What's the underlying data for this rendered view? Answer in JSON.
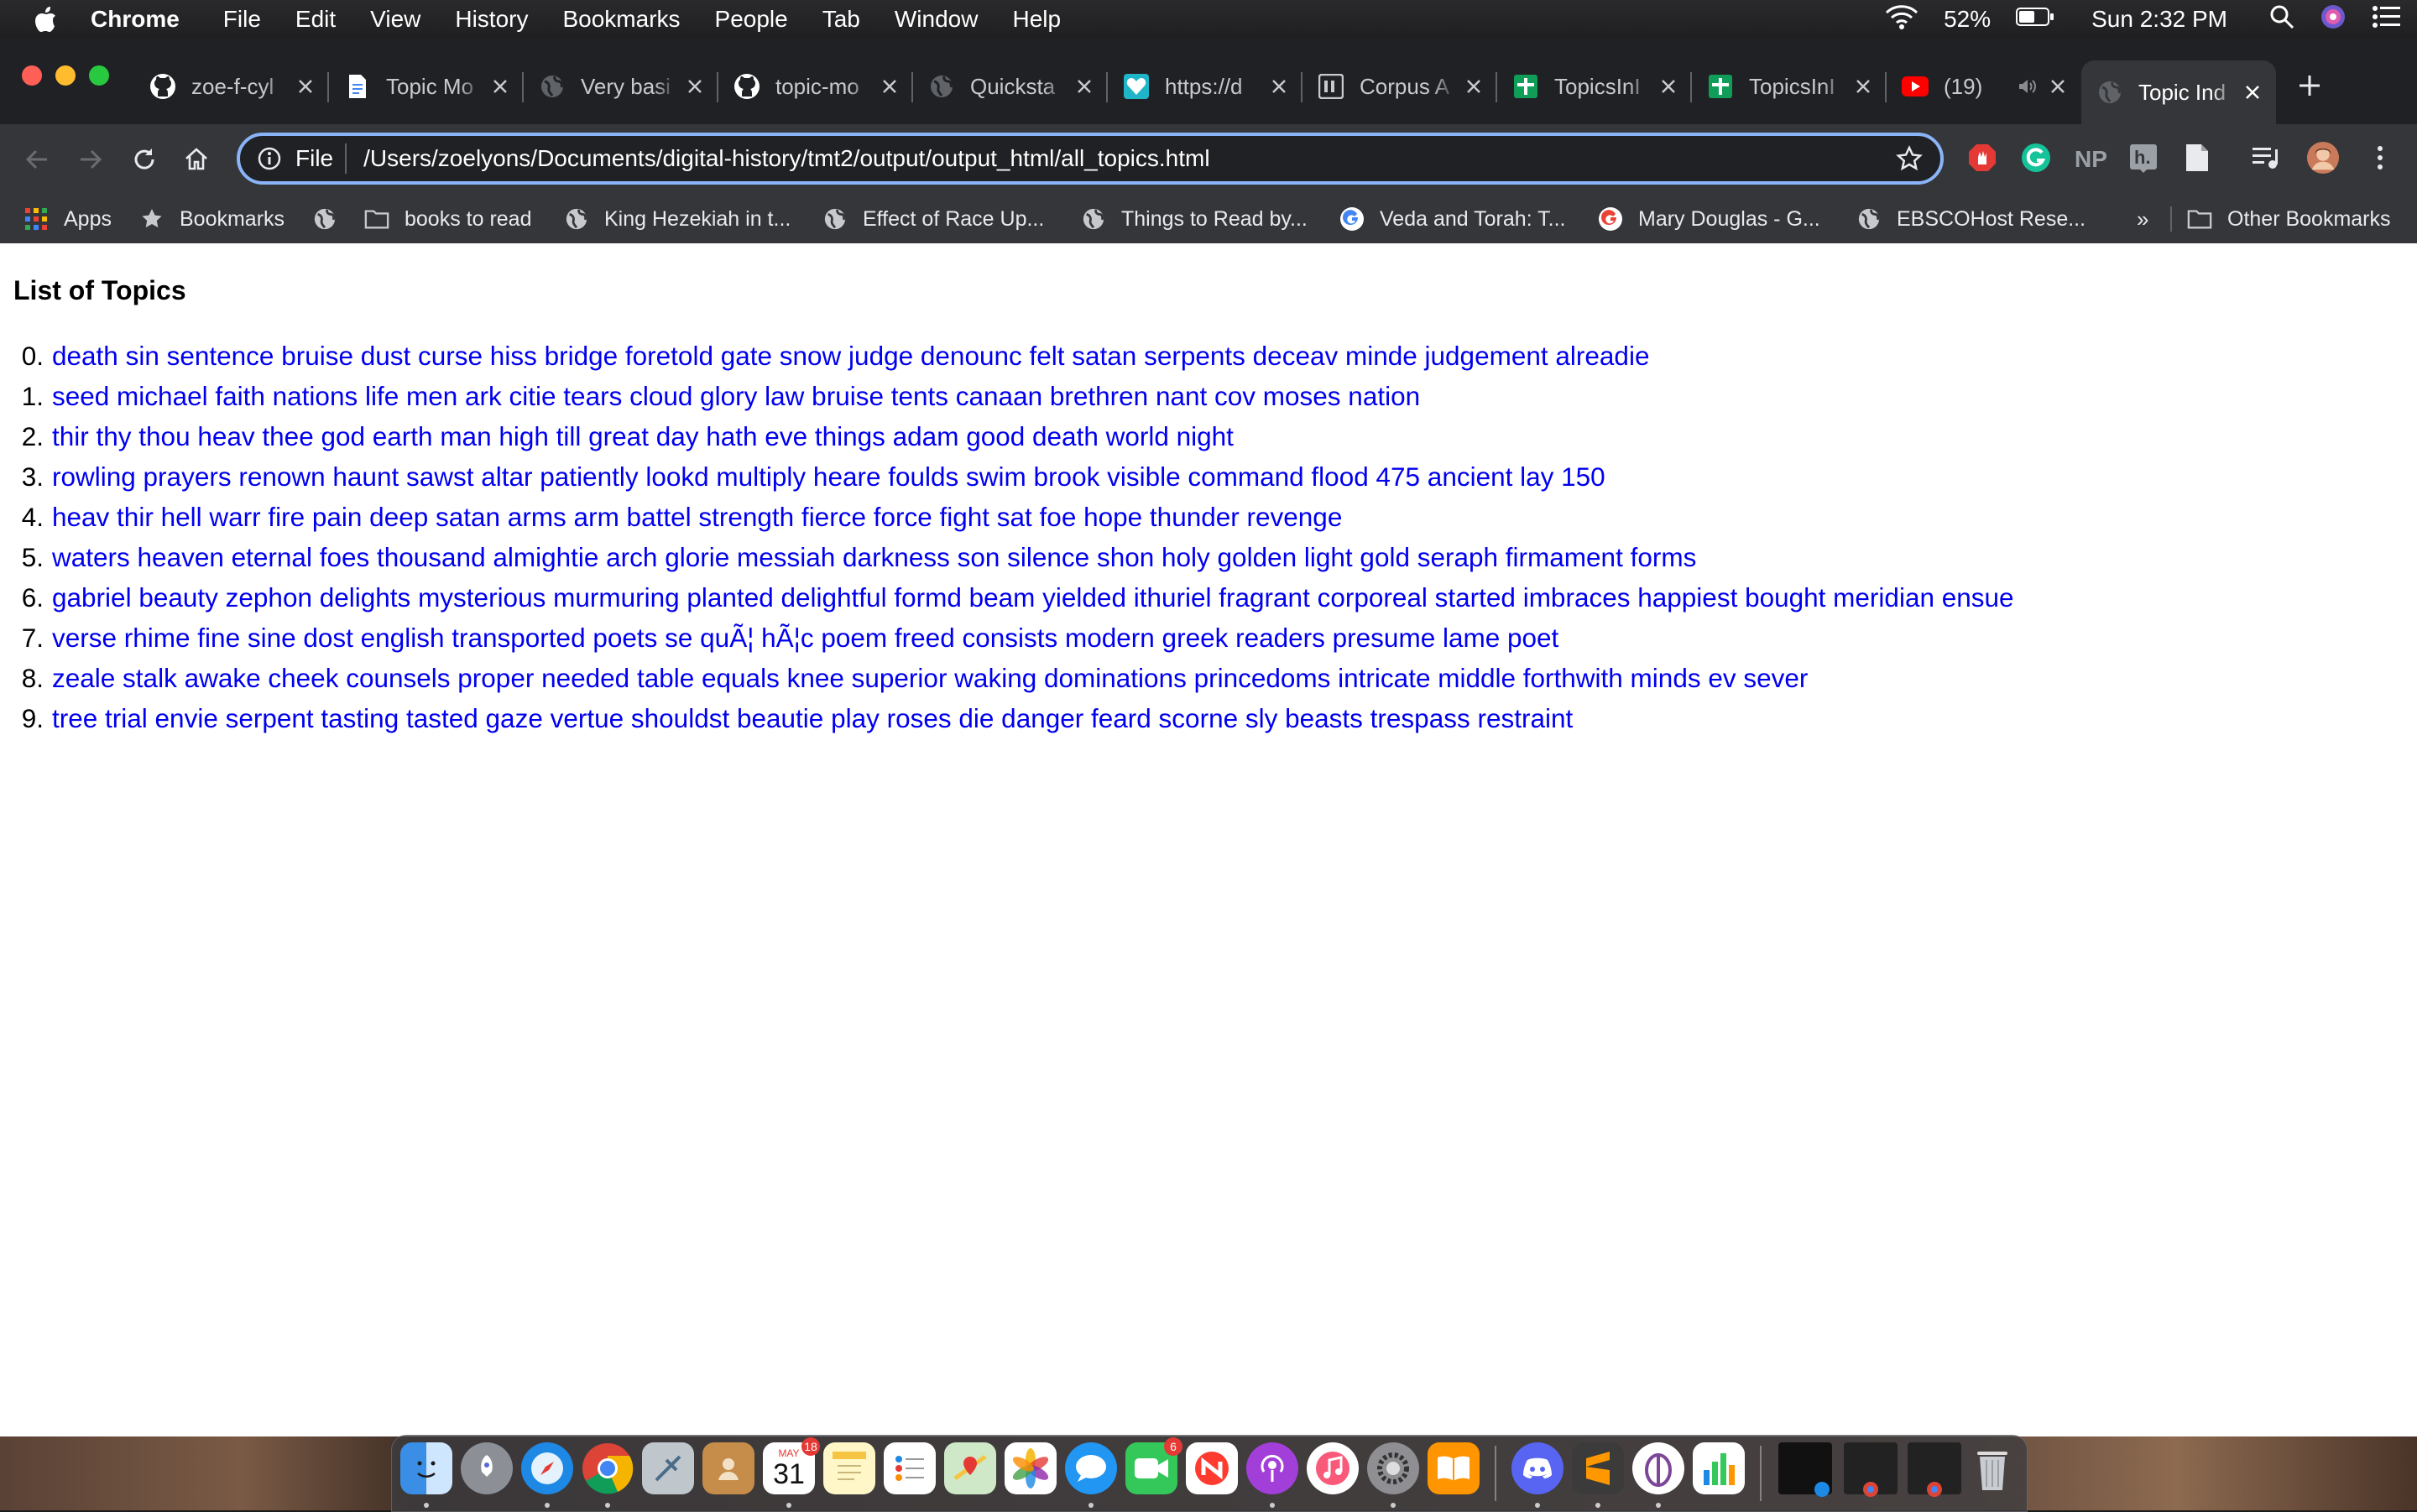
{
  "menubar": {
    "app_name": "Chrome",
    "items": [
      "File",
      "Edit",
      "View",
      "History",
      "Bookmarks",
      "People",
      "Tab",
      "Window",
      "Help"
    ],
    "battery": "52%",
    "clock": "Sun 2:32 PM"
  },
  "tabs": [
    {
      "title": "zoe-f-cyl",
      "icon": "github-icon"
    },
    {
      "title": "Topic Mo",
      "icon": "document-icon"
    },
    {
      "title": "Very basi",
      "icon": "globe-icon"
    },
    {
      "title": "topic-mo",
      "icon": "github-icon"
    },
    {
      "title": "Quicksta",
      "icon": "globe-icon"
    },
    {
      "title": "https://d",
      "icon": "heart-icon"
    },
    {
      "title": "Corpus A",
      "icon": "ph-icon"
    },
    {
      "title": "TopicsInI",
      "icon": "sheets-icon"
    },
    {
      "title": "TopicsInI",
      "icon": "sheets-icon"
    },
    {
      "title": "(19)",
      "icon": "youtube-icon"
    },
    {
      "title": "Topic Ind",
      "icon": "globe-icon",
      "active": true
    }
  ],
  "omnibox": {
    "scheme": "File",
    "url": "/Users/zoelyons/Documents/digital-history/tmt2/output/output_html/all_topics.html"
  },
  "bookmarks": [
    {
      "label": "Apps",
      "icon": "apps-grid-icon"
    },
    {
      "label": "Bookmarks",
      "icon": "star-icon"
    },
    {
      "label": "",
      "icon": "globe-icon"
    },
    {
      "label": "books to read",
      "icon": "folder-icon"
    },
    {
      "label": "King Hezekiah in t...",
      "icon": "globe-icon"
    },
    {
      "label": "Effect of Race Up...",
      "icon": "globe-icon"
    },
    {
      "label": "Things to Read by...",
      "icon": "globe-icon"
    },
    {
      "label": "Veda and Torah: T...",
      "icon": "google-icon"
    },
    {
      "label": "Mary Douglas - G...",
      "icon": "google-icon"
    },
    {
      "label": "EBSCOHost Rese...",
      "icon": "globe-icon"
    }
  ],
  "bookmarks_overflow": "»",
  "other_bookmarks": "Other Bookmarks",
  "page": {
    "title": "List of Topics",
    "topics": [
      {
        "num": "0.",
        "text": "death sin sentence bruise dust curse hiss bridge foretold gate snow judge denounc felt satan serpents deceav minde judgement alreadie"
      },
      {
        "num": "1.",
        "text": "seed michael faith nations life men ark citie tears cloud glory law bruise tents canaan brethren nant cov moses nation"
      },
      {
        "num": "2.",
        "text": "thir thy thou heav thee god earth man high till great day hath eve things adam good death world night"
      },
      {
        "num": "3.",
        "text": "rowling prayers renown haunt sawst altar patiently lookd multiply heare foulds swim brook visible command flood 475 ancient lay 150"
      },
      {
        "num": "4.",
        "text": "heav thir hell warr fire pain deep satan arms arm battel strength fierce force fight sat foe hope thunder revenge"
      },
      {
        "num": "5.",
        "text": "waters heaven eternal foes thousand almightie arch glorie messiah darkness son silence shon holy golden light gold seraph firmament forms"
      },
      {
        "num": "6.",
        "text": "gabriel beauty zephon delights mysterious murmuring planted delightful formd beam yielded ithuriel fragrant corporeal started imbraces happiest bought meridian ensue"
      },
      {
        "num": "7.",
        "text": "verse rhime fine sine dost english transported poets se quÃ¦ hÃ¦c poem freed consists modern greek readers presume lame poet"
      },
      {
        "num": "8.",
        "text": "zeale stalk awake cheek counsels proper needed table equals knee superior waking dominations princedoms intricate middle forthwith minds ev sever"
      },
      {
        "num": "9.",
        "text": "tree trial envie serpent tasting tasted gaze vertue shouldst beautie play roses die danger feard scorne sly beasts trespass restraint"
      }
    ]
  },
  "dock": {
    "calendar_month": "MAY",
    "calendar_day": "31",
    "calendar_badge": "18",
    "facetime_badge": "6"
  },
  "colors": {
    "link": "#0000ee",
    "omnibox_focus": "#8ab4f8",
    "tabstrip": "#202124",
    "toolbar": "#35363a"
  }
}
